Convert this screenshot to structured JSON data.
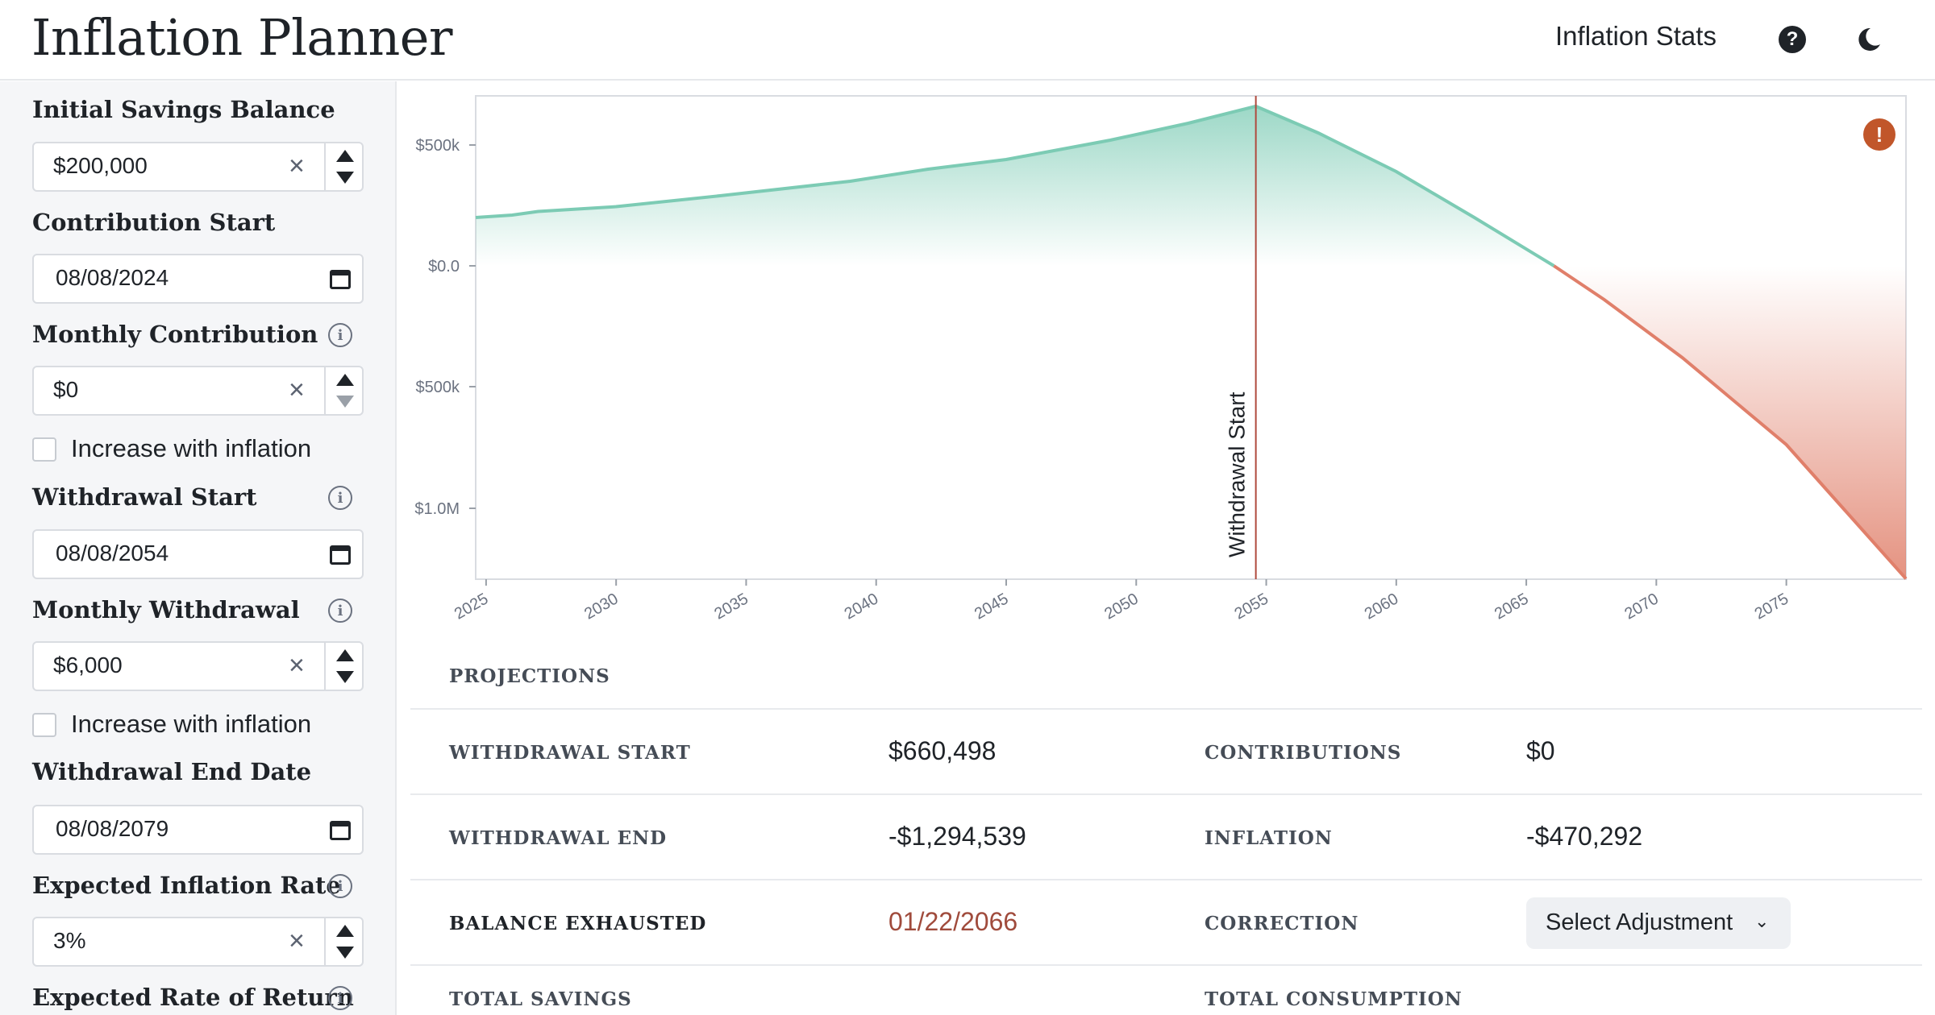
{
  "header": {
    "title": "Inflation Planner",
    "nav_link": "Inflation Stats",
    "help_icon": "?",
    "theme_icon": "moon-icon"
  },
  "sidebar": {
    "initial_savings": {
      "label": "Initial Savings Balance",
      "value": "$200,000"
    },
    "contribution_start": {
      "label": "Contribution Start",
      "value": "08/08/2024"
    },
    "monthly_contribution": {
      "label": "Monthly Contribution",
      "value": "$0",
      "increase_label": "Increase with inflation"
    },
    "withdrawal_start": {
      "label": "Withdrawal Start",
      "value": "08/08/2054"
    },
    "monthly_withdrawal": {
      "label": "Monthly Withdrawal",
      "value": "$6,000",
      "increase_label": "Increase with inflation"
    },
    "withdrawal_end": {
      "label": "Withdrawal End Date",
      "value": "08/08/2079"
    },
    "inflation_rate": {
      "label": "Expected Inflation Rate",
      "value": "3%"
    },
    "rate_of_return": {
      "label": "Expected Rate of Return"
    },
    "clear_glyph": "×",
    "info_glyph": "i"
  },
  "chart_data": {
    "type": "area",
    "x_ticks": [
      "2025",
      "2030",
      "2035",
      "2040",
      "2045",
      "2050",
      "2055",
      "2060",
      "2065",
      "2070",
      "2075"
    ],
    "y_ticks": [
      "$500k",
      "$0.0",
      "$500k",
      "$1.0M"
    ],
    "annotation": "Withdrawal Start",
    "colors": {
      "positive": "#7ccbb4",
      "negative": "#e07f6a",
      "marker": "#b04a3e"
    },
    "x": [
      2024.6,
      2026,
      2027,
      2030,
      2034,
      2039,
      2042,
      2045,
      2049,
      2052,
      2054.6,
      2057,
      2060,
      2063,
      2066.06,
      2068,
      2071,
      2075,
      2079.6
    ],
    "balance": [
      200000,
      210000,
      225000,
      245000,
      290000,
      350000,
      400000,
      440000,
      520000,
      590000,
      660498,
      550000,
      390000,
      200000,
      0,
      -140000,
      -380000,
      -740000,
      -1294539
    ]
  },
  "projections": {
    "title": "PROJECTIONS",
    "rows": [
      {
        "label1": "WITHDRAWAL START",
        "value1": "$660,498",
        "label2": "CONTRIBUTIONS",
        "value2": "$0"
      },
      {
        "label1": "WITHDRAWAL END",
        "value1": "-$1,294,539",
        "label2": "INFLATION",
        "value2": "-$470,292"
      },
      {
        "label1": "BALANCE EXHAUSTED",
        "value1": "01/22/2066",
        "label2": "CORRECTION",
        "value2": "Select Adjustment"
      }
    ],
    "footer": {
      "label1": "TOTAL SAVINGS",
      "label2": "TOTAL CONSUMPTION"
    }
  },
  "warning_icon": "!"
}
